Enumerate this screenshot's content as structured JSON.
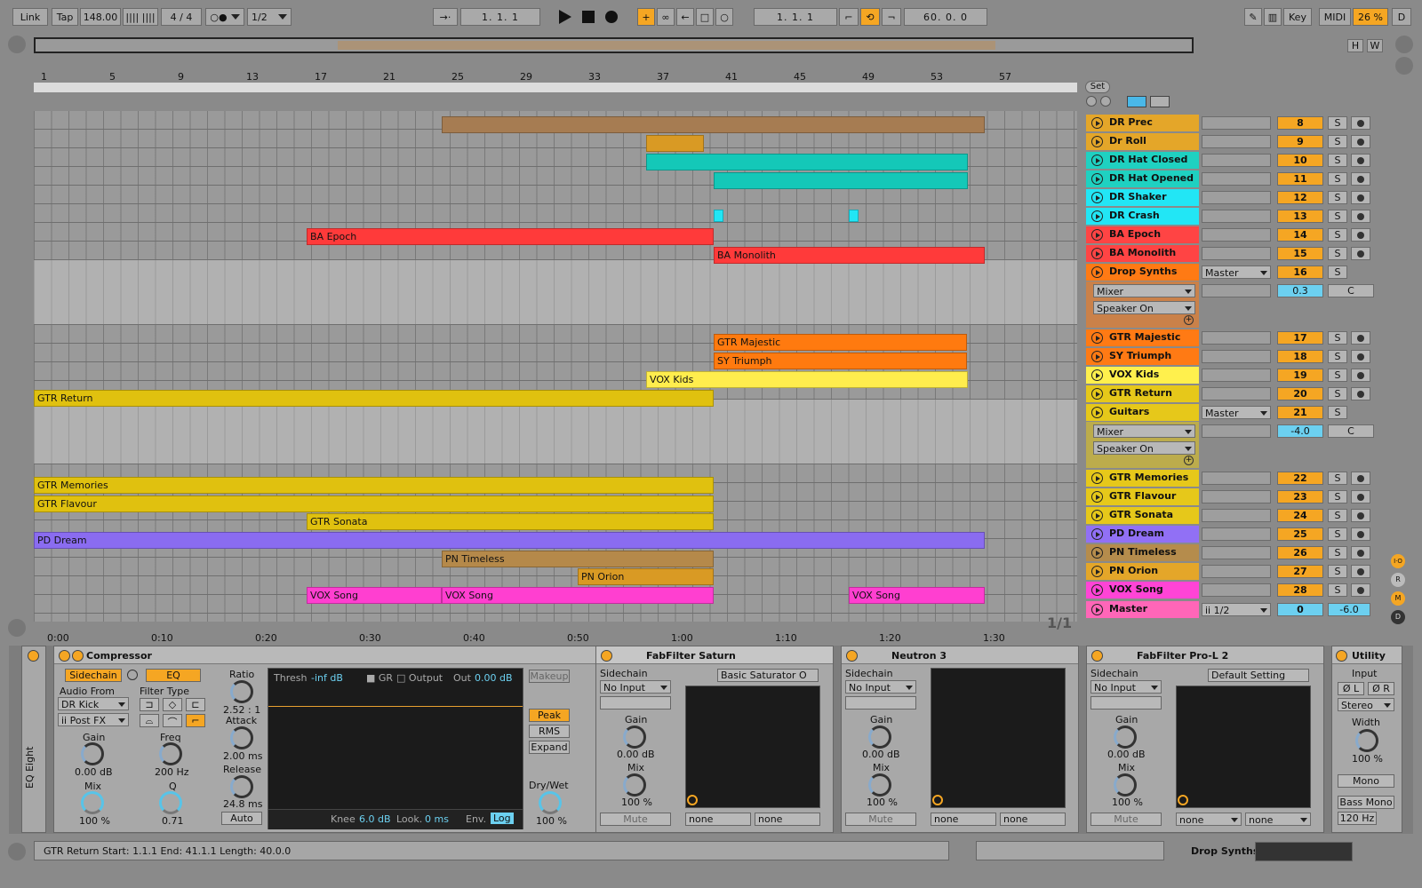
{
  "transport": {
    "link": "Link",
    "tap": "Tap",
    "tempo": "148.00",
    "signature": "4 / 4",
    "quantize": "1/2",
    "arrangement_position": "1.   1.   1",
    "loop_start": "1.   1.   1",
    "loop_length": "60.   0.   0",
    "key": "Key",
    "midi": "MIDI",
    "cpu": "26 %",
    "d": "D",
    "overview_h": "H",
    "overview_w": "W"
  },
  "ruler_bars": [
    "1",
    "5",
    "9",
    "13",
    "17",
    "21",
    "25",
    "29",
    "33",
    "37",
    "41",
    "45",
    "49",
    "53",
    "57"
  ],
  "time_ticks": [
    "0:00",
    "0:10",
    "0:20",
    "0:30",
    "0:40",
    "0:50",
    "1:00",
    "1:10",
    "1:20",
    "1:30"
  ],
  "set_label": "Set",
  "page_indicator": "1/1",
  "clips": [
    {
      "name": "",
      "color": "#a67c52"
    },
    {
      "name": "",
      "color": "#d99a24"
    },
    {
      "name": "",
      "color": "#14c8b8"
    },
    {
      "name": "",
      "color": "#14c8b8"
    },
    {
      "name": "BA Epoch",
      "color": "#ff3a3a"
    },
    {
      "name": "BA Monolith",
      "color": "#ff3a3a"
    },
    {
      "name": "GTR Majestic",
      "color": "#ff7a0f"
    },
    {
      "name": "SY Triumph",
      "color": "#ff7a0f"
    },
    {
      "name": "VOX Kids",
      "color": "#ffed4d"
    },
    {
      "name": "GTR Return",
      "color": "#e0c10f"
    },
    {
      "name": "GTR Memories",
      "color": "#e0c10f"
    },
    {
      "name": "GTR Flavour",
      "color": "#e0c10f"
    },
    {
      "name": "GTR Sonata",
      "color": "#e0c10f"
    },
    {
      "name": "PD Dream",
      "color": "#8a6cf0"
    },
    {
      "name": "PN Timeless",
      "color": "#b5894a"
    },
    {
      "name": "PN Orion",
      "color": "#d99a24"
    },
    {
      "name": "VOX Song",
      "color": "#ff3fd0"
    },
    {
      "name": "VOX Song",
      "color": "#ff3fd0"
    },
    {
      "name": "VOX Song",
      "color": "#ff3fd0"
    }
  ],
  "tracks": [
    {
      "name": "DR Prec",
      "num": "8",
      "solo": "S",
      "color": "#e4a629"
    },
    {
      "name": "Dr Roll",
      "num": "9",
      "solo": "S",
      "color": "#e4a629"
    },
    {
      "name": "DR Hat Closed",
      "num": "10",
      "solo": "S",
      "color": "#1fd1c1"
    },
    {
      "name": "DR Hat Opened",
      "num": "11",
      "solo": "S",
      "color": "#1fd1c1"
    },
    {
      "name": "DR Shaker",
      "num": "12",
      "solo": "S",
      "color": "#22e6f5"
    },
    {
      "name": "DR Crash",
      "num": "13",
      "solo": "S",
      "color": "#22e6f5"
    },
    {
      "name": "BA Epoch",
      "num": "14",
      "solo": "S",
      "color": "#ff4444"
    },
    {
      "name": "BA Monolith",
      "num": "15",
      "solo": "S",
      "color": "#ff4444"
    },
    {
      "name": "Drop Synths",
      "num": "16",
      "solo": "S",
      "color": "#ff7a14",
      "route": "Master",
      "sub1": "Mixer",
      "sub2": "Speaker On",
      "vol": "0.3",
      "pan": "C"
    },
    {
      "name": "GTR Majestic",
      "num": "17",
      "solo": "S",
      "color": "#ff7a14"
    },
    {
      "name": "SY Triumph",
      "num": "18",
      "solo": "S",
      "color": "#ff7a14"
    },
    {
      "name": "VOX Kids",
      "num": "19",
      "solo": "S",
      "color": "#fff04d"
    },
    {
      "name": "GTR Return",
      "num": "20",
      "solo": "S",
      "color": "#e6c81a"
    },
    {
      "name": "Guitars",
      "num": "21",
      "solo": "S",
      "color": "#e6c81a",
      "route": "Master",
      "sub1": "Mixer",
      "sub2": "Speaker On",
      "vol": "-4.0",
      "pan": "C"
    },
    {
      "name": "GTR Memories",
      "num": "22",
      "solo": "S",
      "color": "#e6c81a"
    },
    {
      "name": "GTR Flavour",
      "num": "23",
      "solo": "S",
      "color": "#e6c81a"
    },
    {
      "name": "GTR Sonata",
      "num": "24",
      "solo": "S",
      "color": "#e6c81a"
    },
    {
      "name": "PD Dream",
      "num": "25",
      "solo": "S",
      "color": "#9170f5"
    },
    {
      "name": "PN Timeless",
      "num": "26",
      "solo": "S",
      "color": "#b58c4c"
    },
    {
      "name": "PN Orion",
      "num": "27",
      "solo": "S",
      "color": "#e4a629"
    },
    {
      "name": "VOX Song",
      "num": "28",
      "solo": "S",
      "color": "#ff44d6"
    },
    {
      "name": "Master",
      "num": "0",
      "solo": "",
      "color": "#ff66b8",
      "route": "ii 1/2",
      "vol": "-6.0"
    }
  ],
  "devices": {
    "rack_name": "EQ Eight",
    "compressor": {
      "title": "Compressor",
      "sidechain": "Sidechain",
      "eq": "EQ",
      "audio_from": "Audio From",
      "source": "DR Kick",
      "tap": "ii Post FX",
      "filter_type": "Filter Type",
      "gain_label": "Gain",
      "gain": "0.00 dB",
      "freq_label": "Freq",
      "freq": "200 Hz",
      "mix_label": "Mix",
      "mix": "100 %",
      "q_label": "Q",
      "q": "0.71",
      "ratio_label": "Ratio",
      "ratio": "2.52 : 1",
      "attack_label": "Attack",
      "attack": "2.00 ms",
      "release_label": "Release",
      "release": "24.8 ms",
      "auto": "Auto",
      "thresh_label": "Thresh",
      "thresh": "-inf dB",
      "gr": "GR",
      "output_label": "Output",
      "out_label": "Out",
      "out": "0.00 dB",
      "makeup": "Makeup",
      "peak": "Peak",
      "rms": "RMS",
      "expand": "Expand",
      "knee_label": "Knee",
      "knee": "6.0 dB",
      "look_label": "Look.",
      "look": "0 ms",
      "env_label": "Env.",
      "env": "Log",
      "drywet_label": "Dry/Wet",
      "drywet": "100 %"
    },
    "saturn": {
      "title": "FabFilter Saturn",
      "sidechain": "Sidechain",
      "input": "No Input",
      "preset": "Basic Saturator O",
      "gain_label": "Gain",
      "gain": "0.00 dB",
      "mix_label": "Mix",
      "mix": "100 %",
      "mute": "Mute",
      "none1": "none",
      "none2": "none"
    },
    "neutron": {
      "title": "Neutron 3",
      "sidechain": "Sidechain",
      "input": "No Input",
      "gain_label": "Gain",
      "gain": "0.00 dB",
      "mix_label": "Mix",
      "mix": "100 %",
      "mute": "Mute",
      "none1": "none",
      "none2": "none"
    },
    "prol2": {
      "title": "FabFilter Pro-L 2",
      "sidechain": "Sidechain",
      "input": "No Input",
      "preset": "Default Setting",
      "gain_label": "Gain",
      "gain": "0.00 dB",
      "mix_label": "Mix",
      "mix": "100 %",
      "mute": "Mute",
      "none1": "none",
      "none2": "none"
    },
    "utility": {
      "title": "Utility",
      "input": "Input",
      "phase_l": "Ø L",
      "phase_r": "Ø R",
      "mode": "Stereo",
      "width_label": "Width",
      "width": "100 %",
      "mono": "Mono",
      "bass_mono": "Bass Mono",
      "bass_freq": "120 Hz"
    }
  },
  "status": {
    "text": "GTR Return  Start: 1.1.1  End: 41.1.1  Length: 40.0.0",
    "track": "Drop Synths"
  },
  "right_icons": {
    "io": "I·O",
    "r": "R",
    "m": "M",
    "d": "D"
  }
}
